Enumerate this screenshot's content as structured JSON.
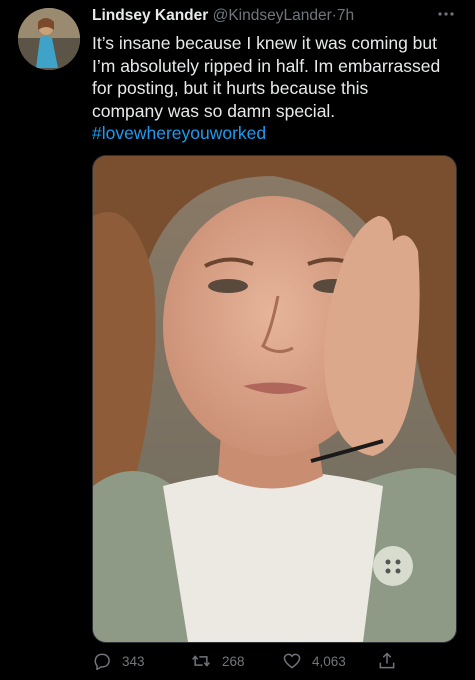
{
  "tweet": {
    "display_name": "Lindsey Kander",
    "handle": "@KindseyLander",
    "separator": "·",
    "time": "7h",
    "text_lines": [
      "It’s insane because I knew it was coming but",
      "I’m absolutely ripped in half. Im embarrassed",
      "for posting, but it hurts because this",
      "company was so damn special."
    ],
    "hashtag": "#lovewhereyouworked",
    "media": {
      "alt": ""
    },
    "actions": {
      "replies": "343",
      "retweets": "268",
      "likes": "4,063"
    },
    "icons": [
      "more-icon",
      "reply-icon",
      "retweet-icon",
      "like-icon",
      "share-icon"
    ]
  },
  "colors": {
    "background": "#000000",
    "text": "#e7e9ea",
    "secondary": "#71767b",
    "link": "#1d9bf0"
  }
}
